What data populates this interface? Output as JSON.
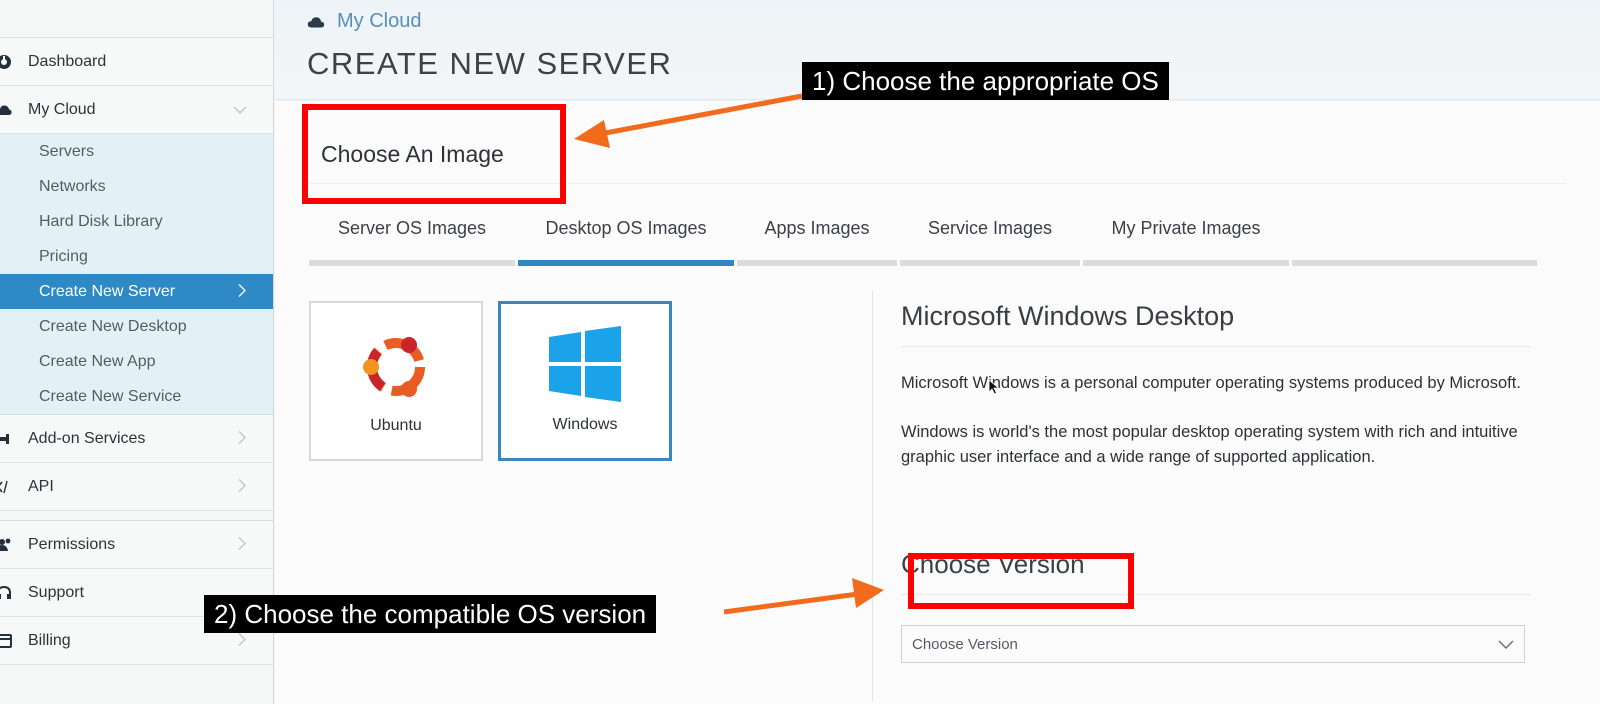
{
  "sidebar": {
    "items_top": [
      {
        "label": "Dashboard",
        "icon": "dashboard-icon"
      },
      {
        "label": "My Cloud",
        "icon": "cloud-icon"
      }
    ],
    "submenu": [
      {
        "label": "Servers"
      },
      {
        "label": "Networks"
      },
      {
        "label": "Hard Disk Library"
      },
      {
        "label": "Pricing"
      },
      {
        "label": "Create New Server",
        "active": true
      },
      {
        "label": "Create New Desktop"
      },
      {
        "label": "Create New App"
      },
      {
        "label": "Create New Service"
      }
    ],
    "items_mid": [
      {
        "label": "Add-on Services",
        "icon": "plug-icon"
      },
      {
        "label": "API",
        "icon": "code-icon"
      }
    ],
    "items_bottom": [
      {
        "label": "Permissions",
        "icon": "users-icon"
      },
      {
        "label": "Support",
        "icon": "headset-icon"
      },
      {
        "label": "Billing",
        "icon": "billing-icon"
      }
    ]
  },
  "header": {
    "breadcrumb": "My Cloud",
    "title": "CREATE NEW SERVER"
  },
  "main": {
    "section_title": "Choose An Image",
    "tabs": [
      {
        "label": "Server OS Images"
      },
      {
        "label": "Desktop OS Images",
        "active": true
      },
      {
        "label": "Apps Images"
      },
      {
        "label": "Service Images"
      },
      {
        "label": "My Private Images"
      }
    ],
    "tiles": [
      {
        "label": "Ubuntu",
        "icon": "ubuntu-logo-icon"
      },
      {
        "label": "Windows",
        "icon": "windows-logo-icon",
        "selected": true
      }
    ],
    "detail": {
      "title": "Microsoft Windows Desktop",
      "paragraph1": "Microsoft Windows is a personal computer operating systems produced by Microsoft.",
      "paragraph2": "Windows is world's the most popular desktop operating system with rich and intuitive graphic user interface and a wide range of supported application."
    },
    "version": {
      "title": "Choose Version",
      "select_value": "Choose Version"
    }
  },
  "annotations": {
    "callout1": "1) Choose the appropriate OS",
    "callout2": "2) Choose the compatible OS version"
  },
  "colors": {
    "accent": "#2f89c5",
    "annotation_red": "#ff0000",
    "arrow_orange": "#f26a1b"
  }
}
